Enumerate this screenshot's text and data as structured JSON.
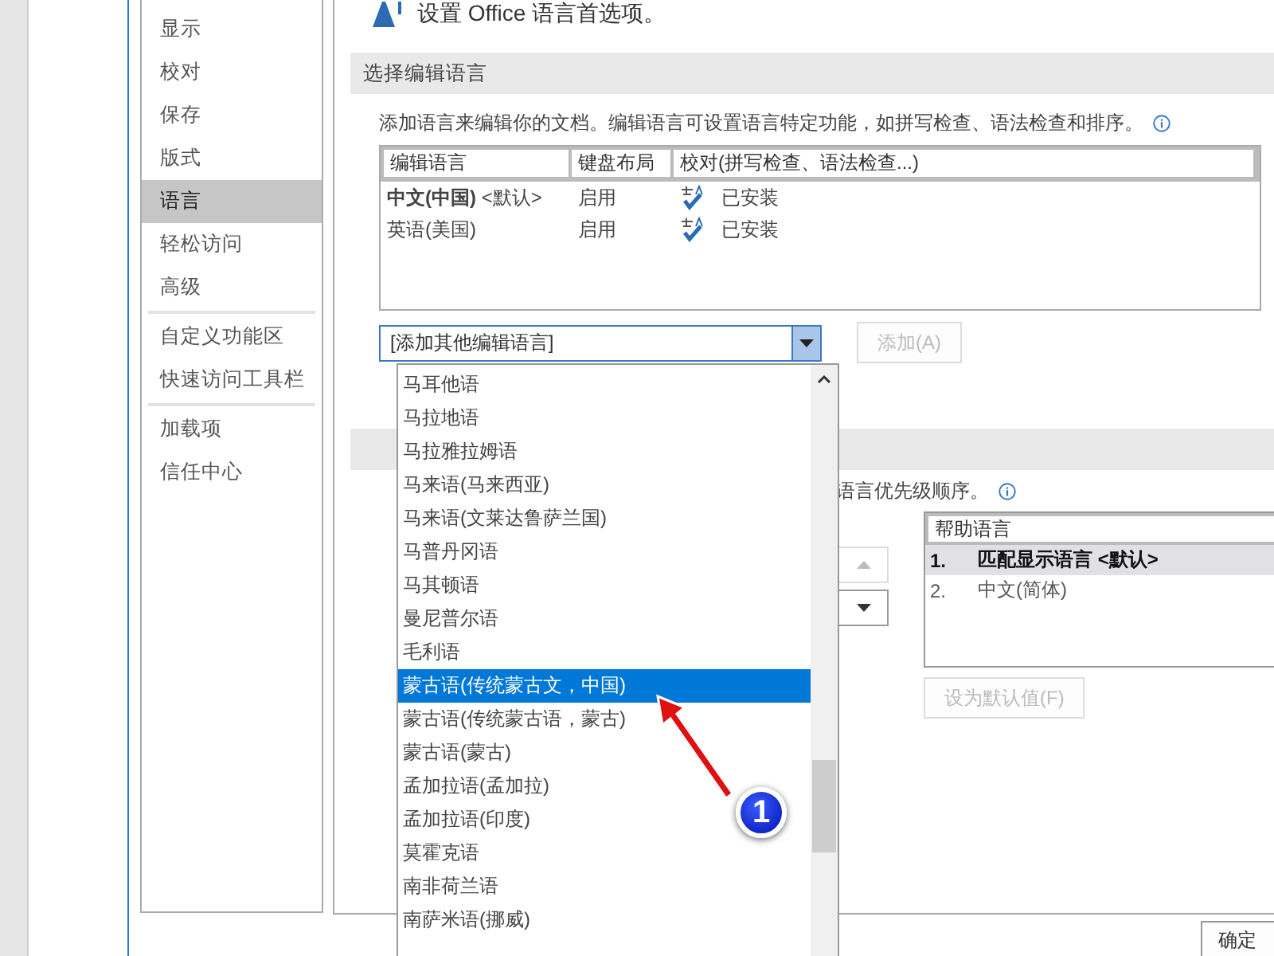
{
  "sidebar": {
    "groups": [
      [
        {
          "label": "显示",
          "selected": false
        },
        {
          "label": "校对",
          "selected": false
        },
        {
          "label": "保存",
          "selected": false
        },
        {
          "label": "版式",
          "selected": false
        },
        {
          "label": "语言",
          "selected": true
        },
        {
          "label": "轻松访问",
          "selected": false
        },
        {
          "label": "高级",
          "selected": false
        }
      ],
      [
        {
          "label": "自定义功能区",
          "selected": false
        },
        {
          "label": "快速访问工具栏",
          "selected": false
        }
      ],
      [
        {
          "label": "加载项",
          "selected": false
        },
        {
          "label": "信任中心",
          "selected": false
        }
      ]
    ]
  },
  "header": {
    "title": "设置 Office 语言首选项。"
  },
  "editing_languages": {
    "title": "选择编辑语言",
    "description": "添加语言来编辑你的文档。编辑语言可设置语言特定功能，如拼写检查、语法检查和排序。",
    "columns": [
      "编辑语言",
      "键盘布局",
      "校对(拼写检查、语法检查...)"
    ],
    "rows": [
      {
        "language": "**中文(中国)** <默认>",
        "keyboard": "启用",
        "proofing": "已安装"
      },
      {
        "language": "英语(美国)",
        "keyboard": "启用",
        "proofing": "已安装"
      }
    ],
    "combo": {
      "value": "[添加其他编辑语言]"
    },
    "add_button": {
      "label": "添加(A)",
      "disabled": true
    }
  },
  "dropdown": {
    "items": [
      {
        "label": "马耳他语",
        "selected": false
      },
      {
        "label": "马拉地语",
        "selected": false
      },
      {
        "label": "马拉雅拉姆语",
        "selected": false
      },
      {
        "label": "马来语(马来西亚)",
        "selected": false
      },
      {
        "label": "马来语(文莱达鲁萨兰国)",
        "selected": false
      },
      {
        "label": "马普丹冈语",
        "selected": false
      },
      {
        "label": "马其顿语",
        "selected": false
      },
      {
        "label": "曼尼普尔语",
        "selected": false
      },
      {
        "label": "毛利语",
        "selected": false
      },
      {
        "label": "蒙古语(传统蒙古文，中国)",
        "selected": true
      },
      {
        "label": "蒙古语(传统蒙古语，蒙古)",
        "selected": false
      },
      {
        "label": "蒙古语(蒙古)",
        "selected": false
      },
      {
        "label": "孟加拉语(孟加拉)",
        "selected": false
      },
      {
        "label": "孟加拉语(印度)",
        "selected": false
      },
      {
        "label": "莫霍克语",
        "selected": false
      },
      {
        "label": "南非荷兰语",
        "selected": false
      },
      {
        "label": "南萨米语(挪威)",
        "selected": false
      }
    ]
  },
  "help_languages": {
    "description": "语言优先级顺序。",
    "column": "帮助语言",
    "rows": [
      {
        "number": "1.",
        "label": "匹配显示语言 <默认>",
        "selected": true
      },
      {
        "number": "2.",
        "label": "中文(简体)",
        "selected": false
      }
    ],
    "set_default_button": {
      "label": "设为默认值(F)",
      "disabled": true
    }
  },
  "ok_button": {
    "label": "确定"
  },
  "callout": {
    "number": "1"
  }
}
